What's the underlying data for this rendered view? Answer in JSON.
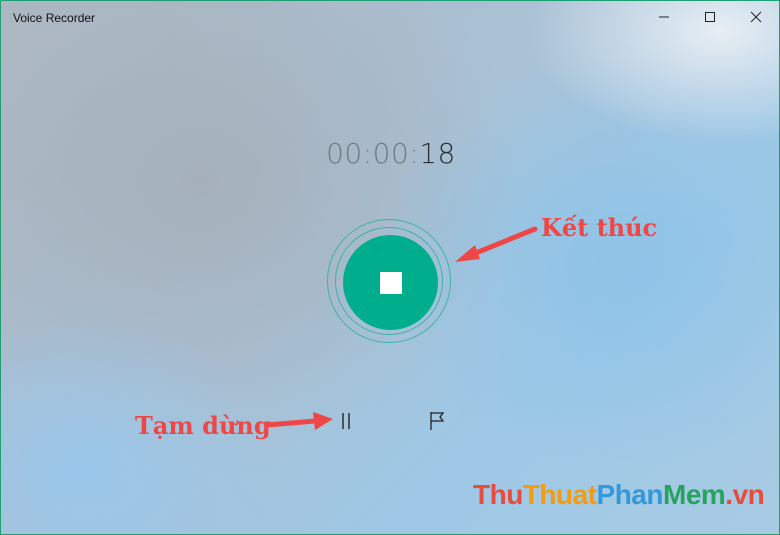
{
  "window": {
    "title": "Voice Recorder"
  },
  "controls": {
    "minimize_icon": "minimize-icon",
    "maximize_icon": "maximize-icon",
    "close_icon": "close-icon"
  },
  "timer": {
    "dim_part": "00:00:",
    "bright_part": "18"
  },
  "buttons": {
    "stop_icon": "stop-icon",
    "pause_icon": "pause-icon",
    "marker_icon": "flag-icon"
  },
  "annotations": {
    "stop_label": "Kết thúc",
    "pause_label": "Tạm dừng",
    "color": "#ef4646"
  },
  "watermark": {
    "part1": "Thu",
    "part2": "Thuat",
    "part3": "Phan",
    "part4": "Mem",
    "part5": ".vn"
  },
  "colors": {
    "accent": "#00ae8e",
    "window_border": "#1f9d73"
  }
}
